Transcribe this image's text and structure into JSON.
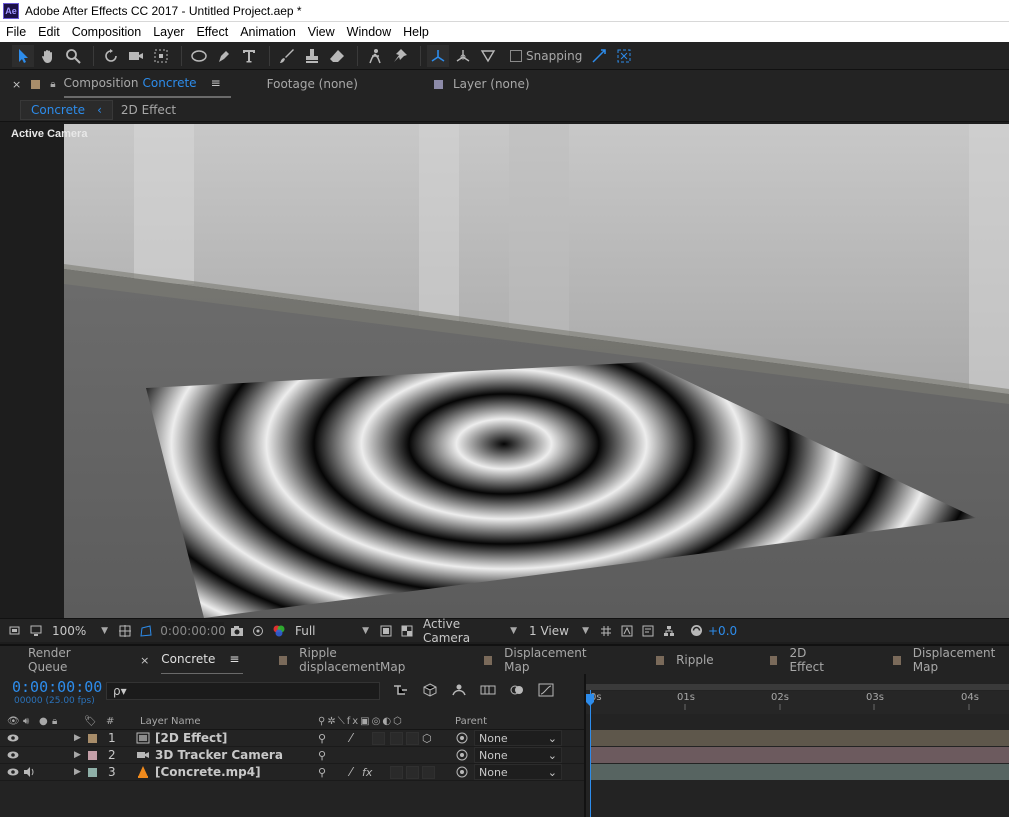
{
  "window": {
    "title": "Adobe After Effects CC 2017 - Untitled Project.aep *",
    "app_badge": "Ae"
  },
  "menu": [
    "File",
    "Edit",
    "Composition",
    "Layer",
    "Effect",
    "Animation",
    "View",
    "Window",
    "Help"
  ],
  "toolbar": {
    "snapping_label": "Snapping"
  },
  "panels": {
    "composition_prefix": "Composition",
    "composition_name": "Concrete",
    "footage_label": "Footage (none)",
    "layer_label": "Layer (none)"
  },
  "comp_subtabs": {
    "active": "Concrete",
    "other": "2D Effect",
    "separator": "‹"
  },
  "viewer": {
    "view_label": "Active Camera",
    "zoom": "100%",
    "timecode": "0:00:00:00",
    "resolution": "Full",
    "camera": "Active Camera",
    "views": "1 View",
    "exposure": "+0.0"
  },
  "timeline_tabs": [
    {
      "label": "Render Queue",
      "active": false,
      "color": null
    },
    {
      "label": "Concrete",
      "active": true,
      "color": null
    },
    {
      "label": "Ripple displacementMap",
      "active": false,
      "color": "#7a6a5a"
    },
    {
      "label": "Displacement Map",
      "active": false,
      "color": "#7a6a5a"
    },
    {
      "label": "Ripple",
      "active": false,
      "color": "#7a6a5a"
    },
    {
      "label": "2D Effect",
      "active": false,
      "color": "#7a6a5a"
    },
    {
      "label": "Displacement Map",
      "active": false,
      "color": "#7a6a5a"
    }
  ],
  "timeline": {
    "timecode": "0:00:00:00",
    "frame_fps": "00000 (25.00 fps)",
    "search_placeholder": "ρ▾",
    "ruler_ticks": [
      "0s",
      "01s",
      "02s",
      "03s",
      "04s"
    ],
    "col_hash": "#",
    "col_layer_name": "Layer Name",
    "col_parent": "Parent"
  },
  "layers": [
    {
      "num": "1",
      "name": "[2D Effect]",
      "label_color": "#a88d6a",
      "parent": "None",
      "track_color": "#5e574b"
    },
    {
      "num": "2",
      "name": "3D Tracker Camera",
      "label_color": "#c49fa8",
      "parent": "None",
      "track_color": "#6c5a5e"
    },
    {
      "num": "3",
      "name": "[Concrete.mp4]",
      "label_color": "#8fb0a8",
      "parent": "None",
      "track_color": "#576461"
    }
  ],
  "colors": {
    "accent": "#2d8ceb",
    "panel": "#232323",
    "background": "#1d1d1d"
  }
}
